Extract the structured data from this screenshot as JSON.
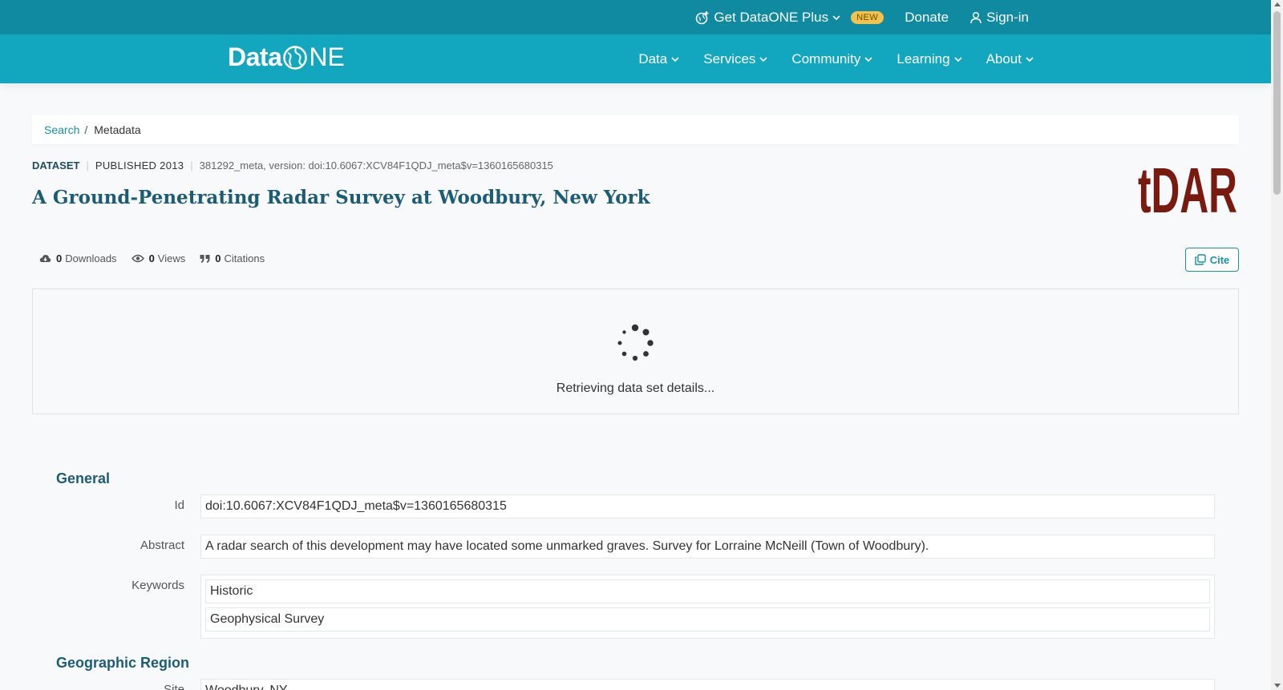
{
  "topbar": {
    "plus_label": "Get DataONE Plus",
    "new_badge": "NEW",
    "donate_label": "Donate",
    "signin_label": "Sign-in"
  },
  "logo": {
    "data": "Data",
    "one": "NE"
  },
  "nav": {
    "items": [
      {
        "label": "Data"
      },
      {
        "label": "Services"
      },
      {
        "label": "Community"
      },
      {
        "label": "Learning"
      },
      {
        "label": "About"
      }
    ]
  },
  "breadcrumb": {
    "search": "Search",
    "separator": "/",
    "current": "Metadata"
  },
  "meta": {
    "type": "DATASET",
    "published": "PUBLISHED 2013",
    "identifier": "381292_meta, version: doi:10.6067:XCV84F1QDJ_meta$v=1360165680315"
  },
  "title": "A Ground-Penetrating Radar Survey at Woodbury, New York",
  "repository_logo": "tDAR",
  "stats": {
    "downloads_count": "0",
    "downloads_label": "Downloads",
    "views_count": "0",
    "views_label": "Views",
    "citations_count": "0",
    "citations_label": "Citations"
  },
  "cite_label": "Cite",
  "loading_text": "Retrieving data set details...",
  "general": {
    "heading": "General",
    "id_label": "Id",
    "id_value": "doi:10.6067:XCV84F1QDJ_meta$v=1360165680315",
    "abstract_label": "Abstract",
    "abstract_value": "A radar search of this development may have located some unmarked graves. Survey for Lorraine McNeill (Town of Woodbury).",
    "keywords_label": "Keywords",
    "keywords": [
      "Historic",
      "Geophysical Survey"
    ]
  },
  "geographic": {
    "heading": "Geographic Region",
    "site_label": "Site",
    "site_value": "Woodbury, NY"
  },
  "colors": {
    "topbar": "#0f8aa0",
    "navbar": "#13a7bf",
    "title": "#1c5d75",
    "tdar": "#7a1a0e",
    "badge": "#f2c14e"
  }
}
